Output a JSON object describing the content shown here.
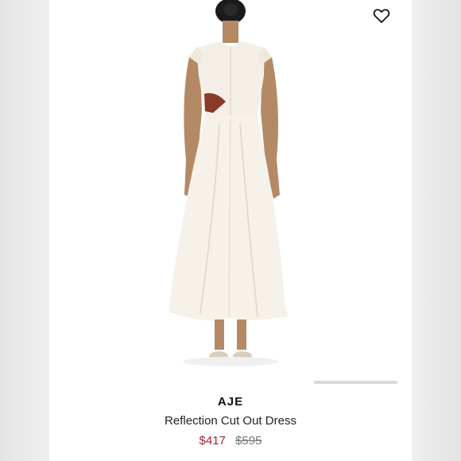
{
  "product": {
    "brand": "AJE",
    "name": "Reflection Cut Out Dress",
    "sale_price": "$417",
    "original_price": "$595"
  },
  "icons": {
    "wishlist": "heart-icon"
  },
  "colors": {
    "sale_price": "#a0283a",
    "original_price": "#777777",
    "dress": "#f4efe6",
    "cutout": "#8a3a28"
  }
}
